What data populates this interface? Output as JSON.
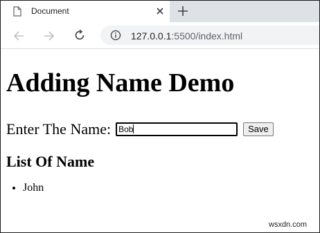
{
  "browser": {
    "tab_title": "Document",
    "url_host": "127.0.0.1",
    "url_rest": ":5500/index.html"
  },
  "page": {
    "heading": "Adding Name Demo",
    "name_label": "Enter The Name:",
    "name_input_value": "Bob",
    "save_button": "Save",
    "list_heading": "List Of Name",
    "names": [
      "John"
    ]
  },
  "watermark": "wsxdn.com"
}
